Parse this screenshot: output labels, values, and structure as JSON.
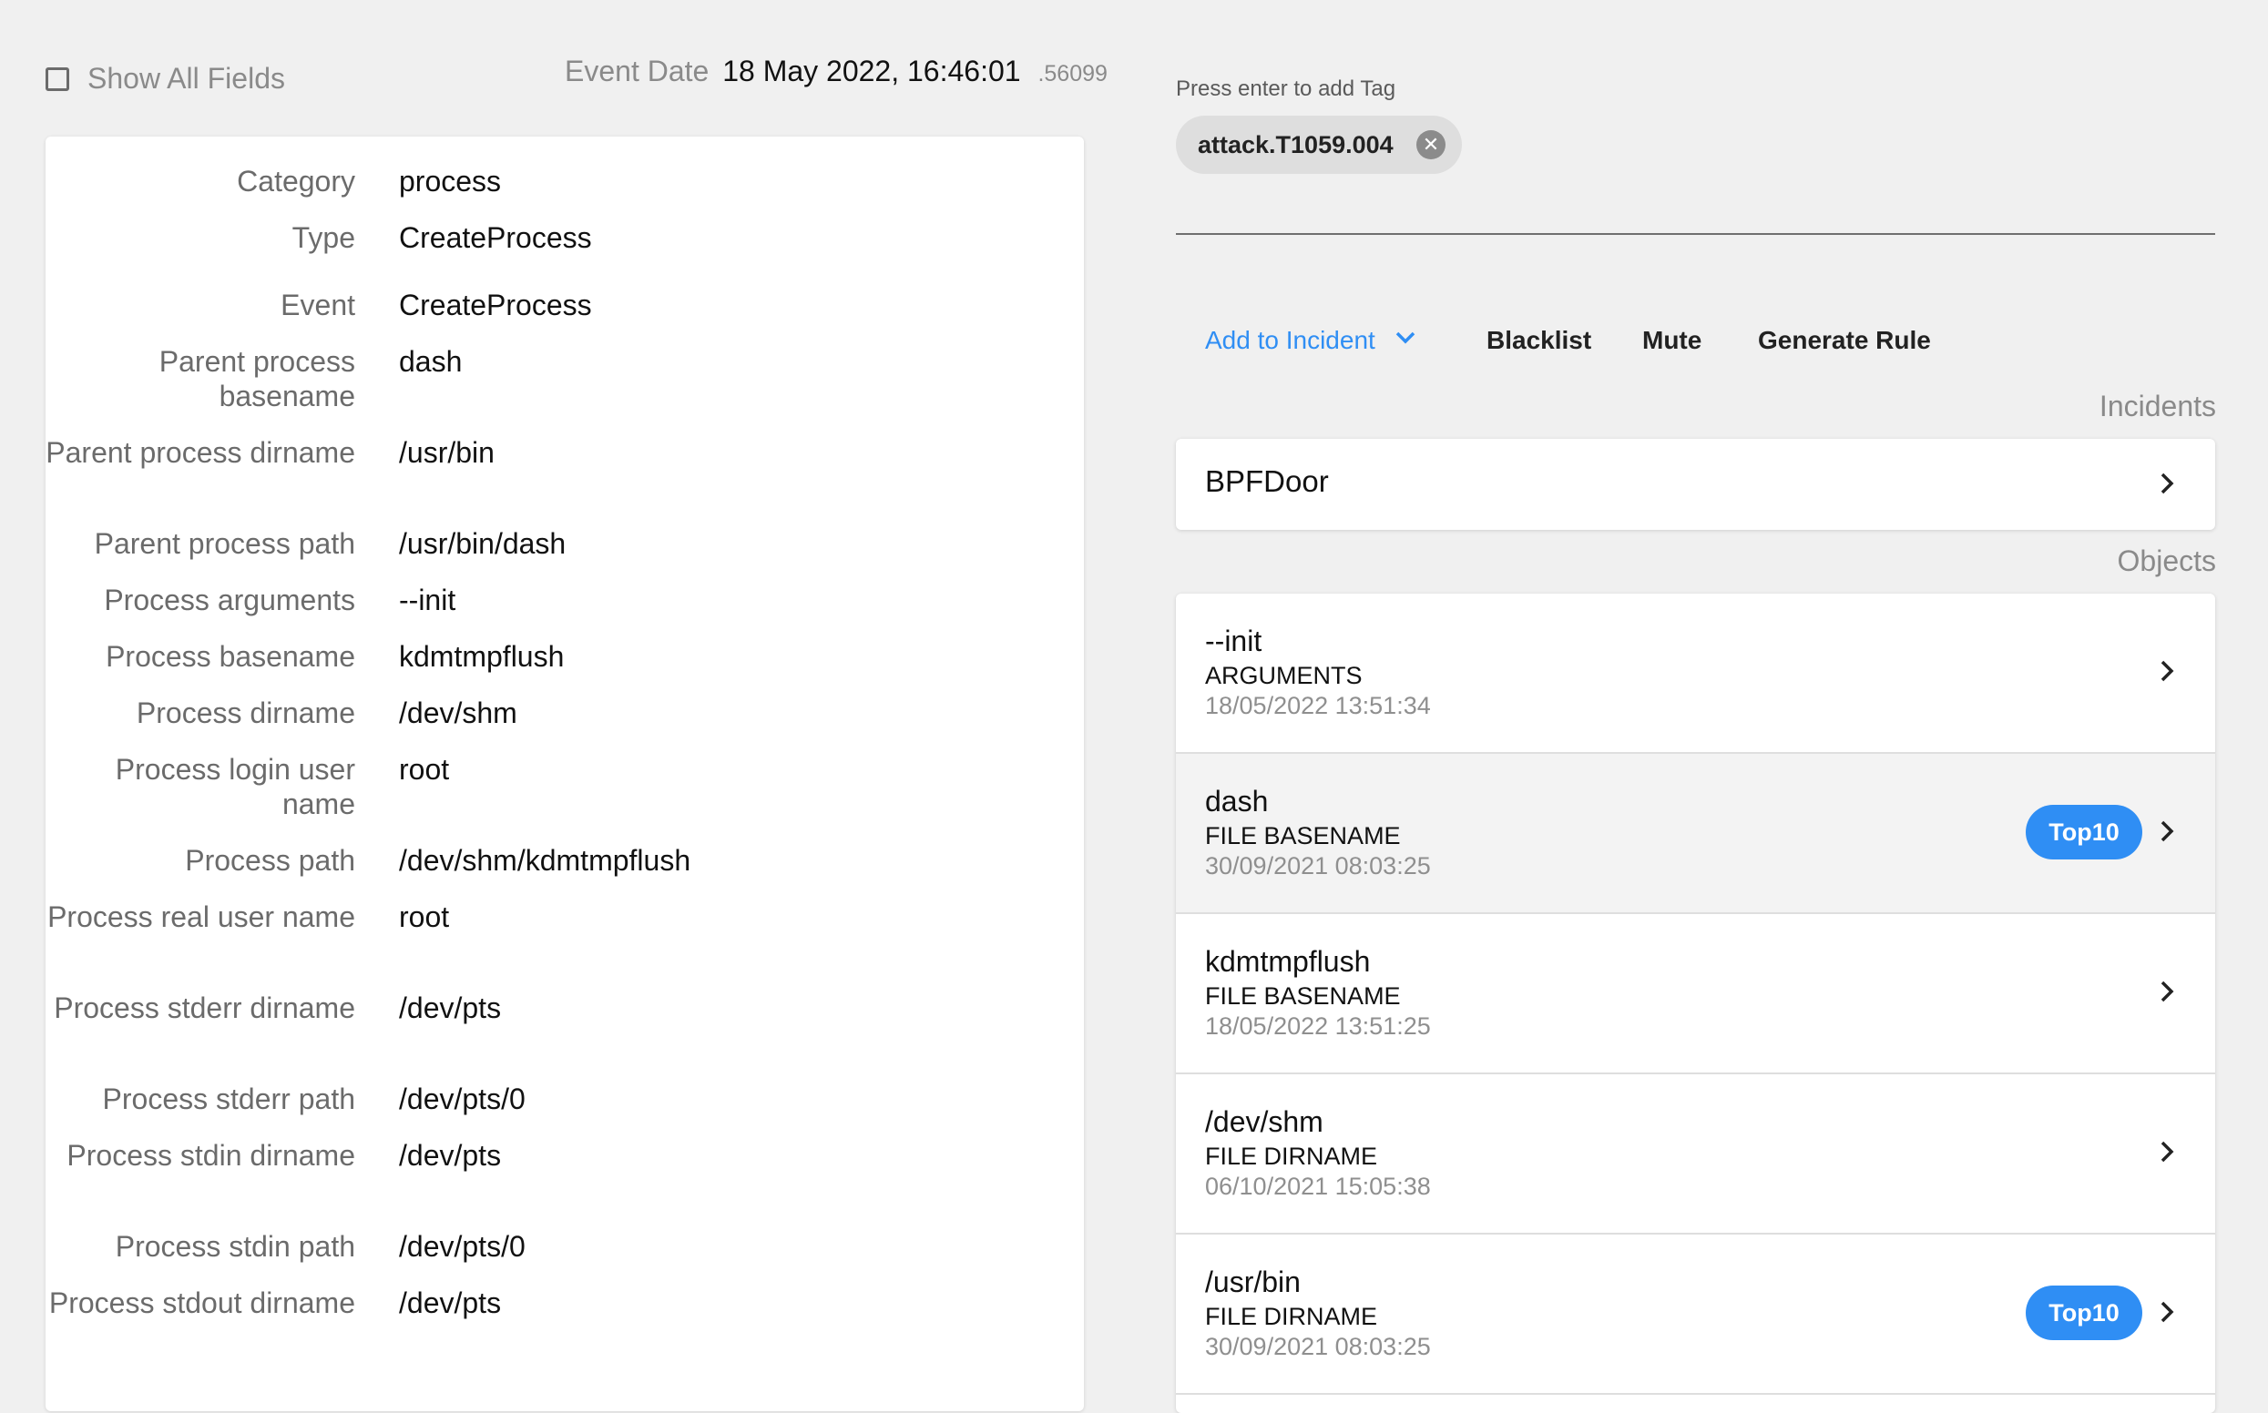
{
  "header": {
    "show_all_label": "Show All Fields",
    "event_date_label": "Event Date",
    "event_date_value": "18 May 2022, 16:46:01",
    "event_date_ms": ".56099"
  },
  "fields": [
    {
      "key": "Category",
      "value": "process"
    },
    {
      "key": "Type",
      "value": "CreateProcess"
    },
    {
      "key": "Event",
      "value": "CreateProcess"
    },
    {
      "key": "Parent process basename",
      "value": "dash"
    },
    {
      "key": "Parent process dirname",
      "value": "/usr/bin"
    },
    {
      "key": "Parent process path",
      "value": "/usr/bin/dash"
    },
    {
      "key": "Process arguments",
      "value": "--init"
    },
    {
      "key": "Process basename",
      "value": "kdmtmpflush"
    },
    {
      "key": "Process dirname",
      "value": "/dev/shm"
    },
    {
      "key": "Process login user name",
      "value": "root"
    },
    {
      "key": "Process path",
      "value": "/dev/shm/kdmtmpflush"
    },
    {
      "key": "Process real user name",
      "value": "root"
    },
    {
      "key": "Process stderr dirname",
      "value": "/dev/pts"
    },
    {
      "key": "Process stderr path",
      "value": "/dev/pts/0"
    },
    {
      "key": "Process stdin dirname",
      "value": "/dev/pts"
    },
    {
      "key": "Process stdin path",
      "value": "/dev/pts/0"
    },
    {
      "key": "Process stdout dirname",
      "value": "/dev/pts"
    }
  ],
  "tags": {
    "hint": "Press enter to add Tag",
    "items": [
      {
        "label": "attack.T1059.004",
        "remove_icon": "close-circle-icon"
      }
    ]
  },
  "actions": {
    "add_to_incident": "Add to Incident",
    "blacklist": "Blacklist",
    "mute": "Mute",
    "generate_rule": "Generate Rule"
  },
  "incidents": {
    "label": "Incidents",
    "items": [
      {
        "name": "BPFDoor"
      }
    ]
  },
  "objects": {
    "label": "Objects",
    "items": [
      {
        "name": "--init",
        "type": "ARGUMENTS",
        "date": "18/05/2022 13:51:34",
        "badge": ""
      },
      {
        "name": "dash",
        "type": "FILE BASENAME",
        "date": "30/09/2021 08:03:25",
        "badge": "Top10"
      },
      {
        "name": "kdmtmpflush",
        "type": "FILE BASENAME",
        "date": "18/05/2022 13:51:25",
        "badge": ""
      },
      {
        "name": "/dev/shm",
        "type": "FILE DIRNAME",
        "date": "06/10/2021 15:05:38",
        "badge": ""
      },
      {
        "name": "/usr/bin",
        "type": "FILE DIRNAME",
        "date": "30/09/2021 08:03:25",
        "badge": "Top10"
      }
    ]
  },
  "colors": {
    "accent": "#2f8ef4",
    "background": "#f0f0f0"
  }
}
